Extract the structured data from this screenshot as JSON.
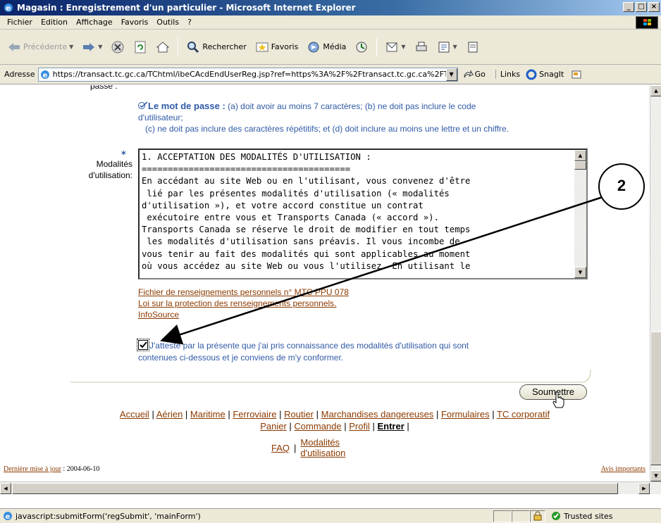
{
  "window": {
    "title": "Magasin : Enregistrement d'un particulier - Microsoft Internet Explorer",
    "controls": [
      "_",
      "□",
      "×"
    ]
  },
  "menu": [
    "Fichier",
    "Edition",
    "Affichage",
    "Favoris",
    "Outils",
    "?"
  ],
  "toolbar": {
    "back": "Précédente",
    "search": "Rechercher",
    "favorites": "Favoris",
    "media": "Média"
  },
  "address": {
    "label": "Adresse",
    "url": "https://transact.tc.gc.ca/TChtml/ibeCAcdEndUserReg.jsp?ref=https%3A%2F%2Ftransact.tc.gc.ca%2FT(",
    "go": "Go",
    "links": "Links",
    "snagit": "SnagIt"
  },
  "page": {
    "cut_label": "passe :",
    "password_note": {
      "bold": "Le mot de passe :",
      "line1": " (a) doit avoir au moins 7 caractères; (b) ne doit pas inclure le code",
      "line2": "d'utilisateur;",
      "line3": "(c) ne doit pas inclure des caractères répétitifs; et (d) doit inclure au moins une lettre et un chiffre."
    },
    "required_mark": "*",
    "terms_label_1": "Modalités",
    "terms_label_2": "d'utilisation:",
    "terms_text": "1. ACCEPTATION DES MODALITÉS D'UTILISATION :\n========================================\nEn accédant au site Web ou en l'utilisant, vous convenez d'être\n lié par les présentes modalités d'utilisation (« modalités\nd'utilisation »), et votre accord constitue un contrat\n exécutoire entre vous et Transports Canada (« accord »).\nTransports Canada se réserve le droit de modifier en tout temps\n les modalités d'utilisation sans préavis. Il vous incombe de\nvous tenir au fait des modalités qui sont applicables au moment\noù vous accédez au site Web ou vous l'utilisez. En utilisant le",
    "links": [
      "Fichier de renseignements personnels n° MTC PPU 078",
      "Loi sur la protection des renseignements personnels.",
      "InfoSource"
    ],
    "attest_checked": true,
    "attest_line1": "J'atteste par la présente que j'ai pris connaissance des modalités d'utilisation qui sont",
    "attest_line2": "contenues ci-dessous et je conviens de m'y conformer.",
    "submit": "Soumettre",
    "footer_nav_1": [
      "Accueil",
      "Aérien",
      "Maritime",
      "Ferroviaire",
      "Routier",
      "Marchandises dangereuses",
      "Formulaires",
      "TC corporatif"
    ],
    "footer_nav_2": [
      "Panier",
      "Commande",
      "Profil",
      "Entrer"
    ],
    "faq": "FAQ",
    "terms_link_1": "Modalités",
    "terms_link_2": "d'utilisation",
    "last_update_label": "Dernière mise à jour",
    "last_update_value": " : 2004-06-10",
    "notices": "Avis importants"
  },
  "status": {
    "text": "javascript:submitForm('regSubmit', 'mainForm')",
    "zone": "Trusted sites"
  },
  "annotation": {
    "number": "2"
  },
  "colors": {
    "link": "#8b3a00",
    "blue_text": "#2f5aa6",
    "titlebar": "#0a246a"
  }
}
